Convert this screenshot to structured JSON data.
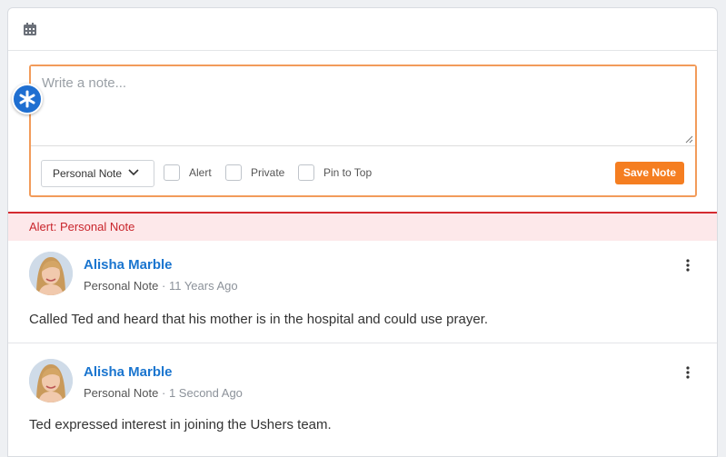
{
  "compose": {
    "placeholder": "Write a note...",
    "note_type": "Personal Note",
    "checkboxes": [
      {
        "label": "Alert"
      },
      {
        "label": "Private"
      },
      {
        "label": "Pin to Top"
      }
    ],
    "save_label": "Save Note",
    "accent": "#f57e21"
  },
  "alert_banner": {
    "text": "Alert: Personal Note",
    "color": "#c9252c"
  },
  "notes": [
    {
      "author": "Alisha Marble",
      "type": "Personal Note",
      "separator": " · ",
      "ago": "11 Years Ago",
      "text": "Called Ted and heard that his mother is in the hospital and could use prayer."
    },
    {
      "author": "Alisha Marble",
      "type": "Personal Note",
      "separator": " · ",
      "ago": "1 Second Ago",
      "text": "Ted expressed interest in joining the Ushers team."
    }
  ],
  "icons": {
    "header": "calendar-icon",
    "required": "asterisk-icon",
    "menu": "kebab-menu-icon"
  }
}
